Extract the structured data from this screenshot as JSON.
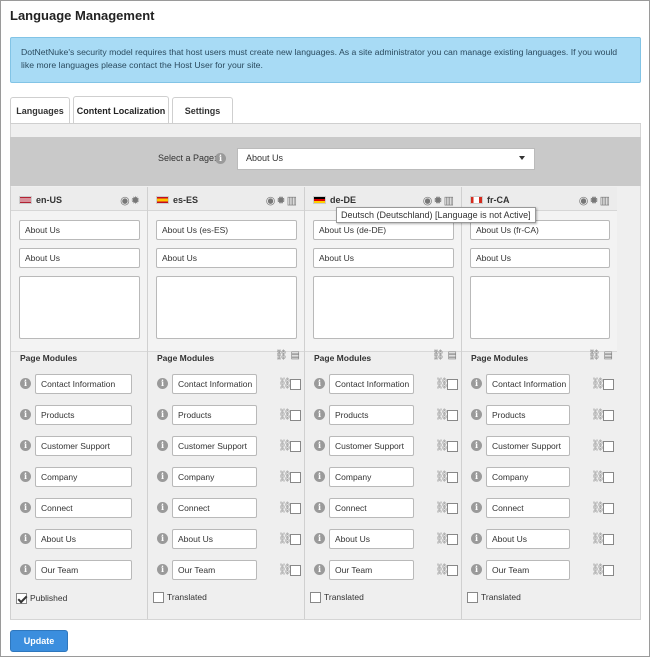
{
  "page": {
    "title": "Language Management"
  },
  "info_message": "DotNetNuke's security model requires that host users must create new languages. As a site administrator you can manage existing languages. If you would like more languages please contact the Host User for your site.",
  "tabs": [
    {
      "label": "Languages",
      "active": false
    },
    {
      "label": "Content Localization",
      "active": true
    },
    {
      "label": "Settings",
      "active": false
    }
  ],
  "page_selector": {
    "label": "Select a Page:",
    "value": "About Us"
  },
  "tooltip": "Deutsch (Deutschland) [Language is not Active]",
  "columns": [
    {
      "code": "en-US",
      "flag": "us-flag",
      "icons": [
        "eye-icon",
        "gear-icon"
      ],
      "name": "About Us",
      "title": "About Us",
      "modules_label": "Page Modules",
      "modules": [
        "Contact Information",
        "Products",
        "Customer Support",
        "Company",
        "Connect",
        "About Us",
        "Our Team"
      ],
      "footer_label": "Published",
      "footer_checked": true
    },
    {
      "code": "es-ES",
      "flag": "es-flag",
      "icons": [
        "eye-icon",
        "gear-icon",
        "trash-icon"
      ],
      "name": "About Us (es-ES)",
      "title": "About Us",
      "modules_label": "Page Modules",
      "modules": [
        "Contact Information",
        "Products",
        "Customer Support",
        "Company",
        "Connect",
        "About Us",
        "Our Team"
      ],
      "footer_label": "Translated",
      "footer_checked": false
    },
    {
      "code": "de-DE",
      "flag": "de-flag",
      "icons": [
        "eye-icon",
        "gear-icon",
        "trash-icon"
      ],
      "name": "About Us (de-DE)",
      "title": "About Us",
      "modules_label": "Page Modules",
      "modules": [
        "Contact Information",
        "Products",
        "Customer Support",
        "Company",
        "Connect",
        "About Us",
        "Our Team"
      ],
      "footer_label": "Translated",
      "footer_checked": false
    },
    {
      "code": "fr-CA",
      "flag": "ca-flag",
      "icons": [
        "eye-icon",
        "gear-icon",
        "trash-icon"
      ],
      "name": "About Us (fr-CA)",
      "title": "About Us",
      "modules_label": "Page Modules",
      "modules": [
        "Contact Information",
        "Products",
        "Customer Support",
        "Company",
        "Connect",
        "About Us",
        "Our Team"
      ],
      "footer_label": "Translated",
      "footer_checked": false
    }
  ],
  "update_button": "Update"
}
